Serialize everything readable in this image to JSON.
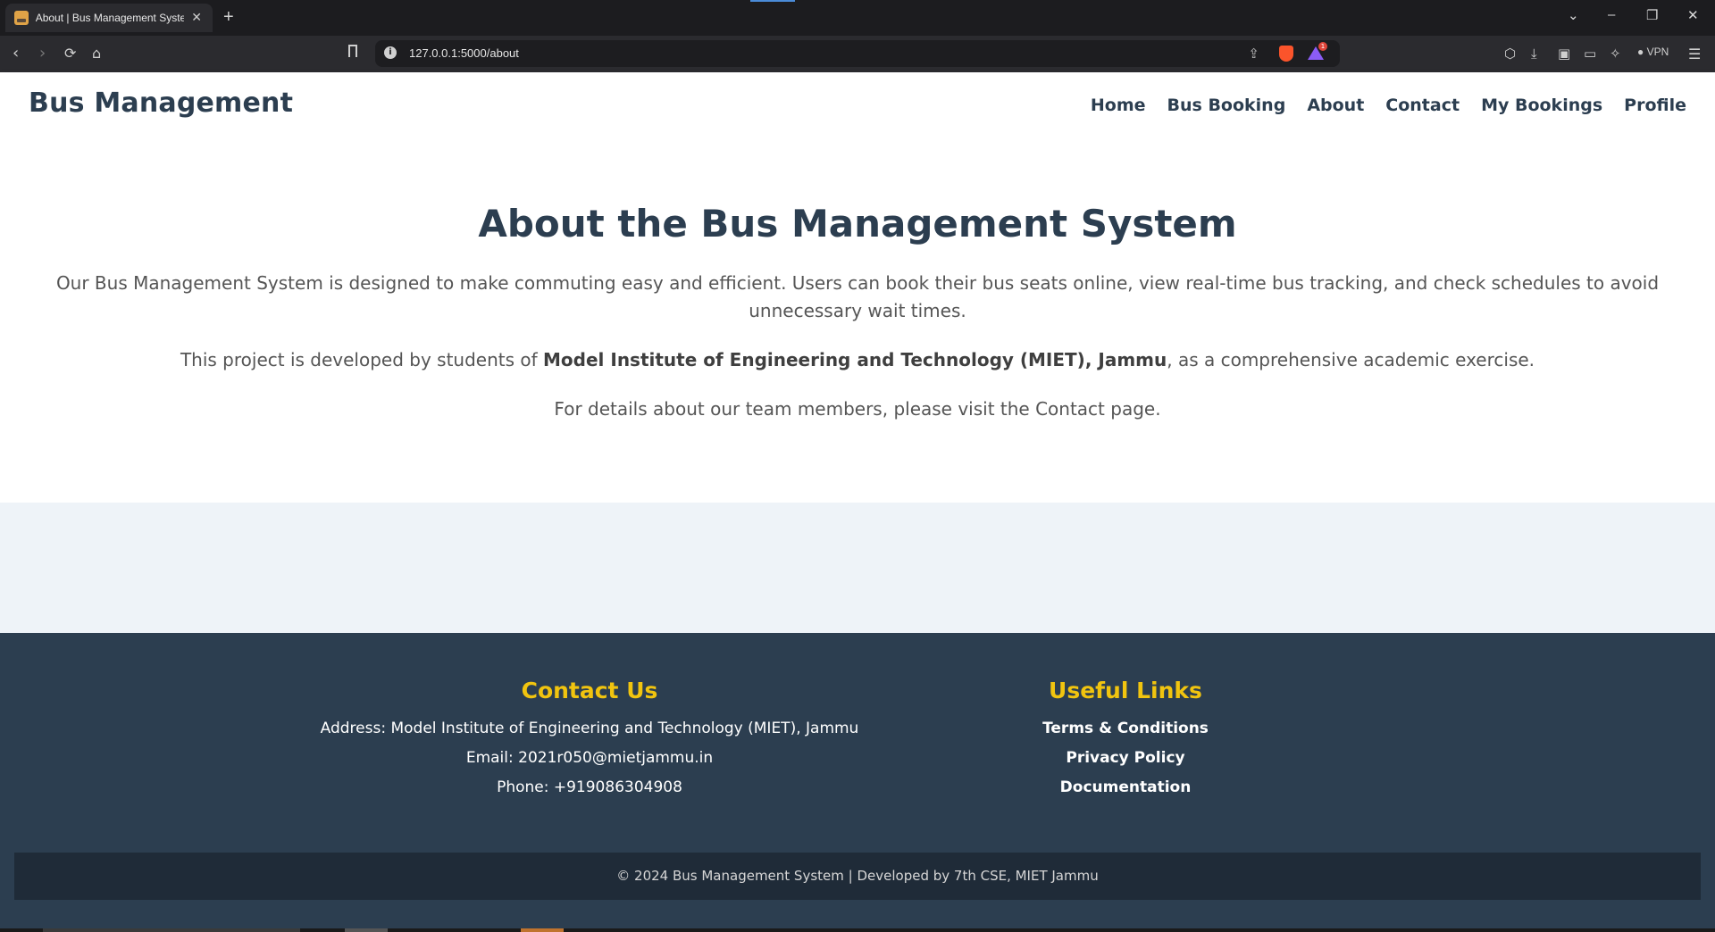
{
  "browser": {
    "tab_title": "About | Bus Management System",
    "tab_close": "✕",
    "new_tab": "+",
    "url": "127.0.0.1:5000/about",
    "vpn_label": "VPN",
    "controls": {
      "tabs_dropdown": "⌄",
      "minimize": "–",
      "restore": "❐",
      "close": "✕"
    }
  },
  "header": {
    "brand": "Bus Management",
    "nav": [
      "Home",
      "Bus Booking",
      "About",
      "Contact",
      "My Bookings",
      "Profile"
    ]
  },
  "about": {
    "title": "About the Bus Management System",
    "p1": "Our Bus Management System is designed to make commuting easy and efficient. Users can book their bus seats online, view real-time bus tracking, and check schedules to avoid unnecessary wait times.",
    "p2_before": "This project is developed by students of ",
    "p2_bold": "Model Institute of Engineering and Technology (MIET), Jammu",
    "p2_after": ", as a comprehensive academic exercise.",
    "p3": "For details about our team members, please visit the Contact page."
  },
  "footer": {
    "contact": {
      "heading": "Contact Us",
      "address": "Address: Model Institute of Engineering and Technology (MIET), Jammu",
      "email": "Email: 2021r050@mietjammu.in",
      "phone": "Phone: +919086304908"
    },
    "links": {
      "heading": "Useful Links",
      "items": [
        "Terms & Conditions",
        "Privacy Policy",
        "Documentation"
      ]
    },
    "copyright": "© 2024 Bus Management System | Developed by 7th CSE, MIET Jammu"
  },
  "colors": {
    "brand": "#2c3e50",
    "footer_bg": "#2c3e50",
    "footer_heading": "#f1c40f",
    "band": "#eef3f8"
  }
}
